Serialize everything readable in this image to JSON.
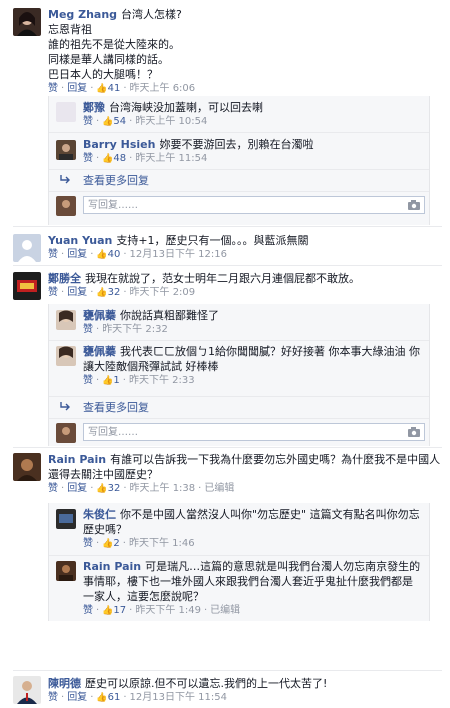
{
  "labels": {
    "like": "赞",
    "reply": "回复",
    "view_more": "查看更多回复",
    "reply_placeholder": "写回复……",
    "edited": "已编辑"
  },
  "comments": [
    {
      "author": "Meg Zhang",
      "text": "台湾人怎樣?\n忘恩背祖\n誰的祖先不是從大陸來的。\n同樣是華人講同樣的話。\n巴日本人的大腿嗎！？",
      "likes": "41",
      "time": "昨天上午 6:06",
      "replies": [
        {
          "author": "鄭豫",
          "text": "台湾海峡没加蓋喇，可以回去喇",
          "likes": "54",
          "time": "昨天上午 10:54"
        },
        {
          "author": "Barry Hsieh",
          "text": "妳要不要游回去，別賴在台濁啦",
          "likes": "48",
          "time": "昨天上午 11:54"
        }
      ]
    },
    {
      "author": "Yuan Yuan",
      "text": "支持+1，歷史只有一個。。。與藍派無關",
      "likes": "40",
      "time": "12月13日下午 12:16"
    },
    {
      "author": "鄭勝全",
      "text": "我現在就說了，范女士明年二月跟六月連個屁都不敢放。",
      "likes": "32",
      "time": "昨天下午 2:09",
      "replies": [
        {
          "author": "甕佩蓁",
          "text": "你說話真粗鄙難怪了",
          "time": "昨天下午 2:32"
        },
        {
          "author": "甕佩蓁",
          "text": "我代表ㄈㄈ放個ㄅ1給你聞聞膩？好好接著 你本事大綠油油 你讓大陸敵個飛彈試試 好棒棒",
          "likes": "1",
          "time": "昨天下午 2:33"
        }
      ]
    },
    {
      "author": "Rain Pain",
      "text": "有誰可以告訴我一下我為什麼要勿忘外國史嗎？為什麼我不是中國人還得去關注中國歷史？",
      "likes": "32",
      "time": "昨天上午 1:38",
      "edited": true,
      "replies": [
        {
          "author": "朱俊仁",
          "text": "你不是中國人當然沒人叫你\"勿忘歷史\" 這篇文有點名叫你勿忘歷史嗎？",
          "likes": "2",
          "time": "昨天下午 1:46"
        },
        {
          "author": "Rain Pain",
          "text": "可是瑞凡…這篇的意思就是叫我們台濁人勿忘南京發生的事情耶，樓下也一堆外國人來跟我們台濁人套近乎鬼扯什麼我們都是一家人，這要怎麼說呢？",
          "likes": "17",
          "time": "昨天下午 1:49",
          "edited": true
        }
      ]
    },
    {
      "author": "陳明德",
      "text": "歷史可以原諒.但不可以遺忘.我們的上一代太苦了!",
      "likes": "61",
      "time": "12月13日下午 11:54"
    }
  ],
  "colors": {
    "link": "#3b5998",
    "meta": "#9197a3",
    "reply_bg": "#f6f7f9"
  }
}
